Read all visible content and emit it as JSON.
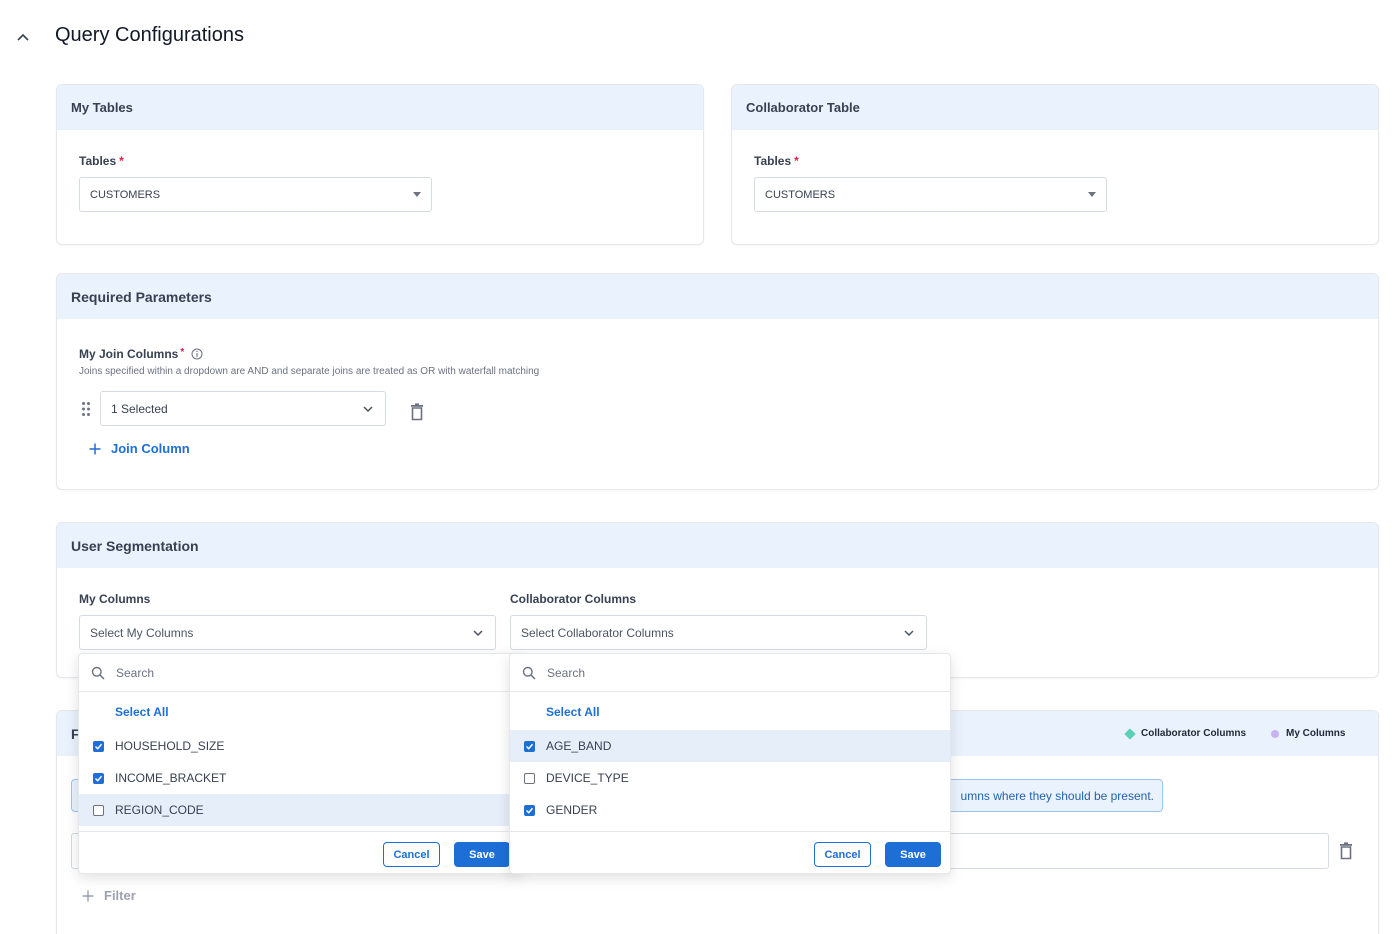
{
  "page": {
    "title": "Query Configurations"
  },
  "my_tables": {
    "header": "My Tables",
    "tables_label": "Tables",
    "required_mark": "*",
    "selected_table": "CUSTOMERS"
  },
  "collaborator_table": {
    "header": "Collaborator Table",
    "tables_label": "Tables",
    "required_mark": "*",
    "selected_table": "CUSTOMERS"
  },
  "required_parameters": {
    "header": "Required Parameters",
    "join_label": "My Join Columns",
    "required_mark": "*",
    "hint": "Joins specified within a dropdown are AND and separate joins are treated as OR with waterfall matching",
    "join_select_value": "1 Selected",
    "add_join_label": "Join Column"
  },
  "user_segmentation": {
    "header": "User Segmentation",
    "my_columns_label": "My Columns",
    "my_columns_placeholder": "Select My Columns",
    "collab_columns_label": "Collaborator Columns",
    "collab_columns_placeholder": "Select Collaborator Columns"
  },
  "my_columns_dropdown": {
    "search_placeholder": "Search",
    "select_all": "Select All",
    "items": [
      {
        "label": "HOUSEHOLD_SIZE",
        "checked": true
      },
      {
        "label": "INCOME_BRACKET",
        "checked": true
      },
      {
        "label": "REGION_CODE",
        "checked": false
      }
    ],
    "cancel": "Cancel",
    "save": "Save"
  },
  "collab_columns_dropdown": {
    "search_placeholder": "Search",
    "select_all": "Select All",
    "items": [
      {
        "label": "AGE_BAND",
        "checked": true
      },
      {
        "label": "DEVICE_TYPE",
        "checked": false
      },
      {
        "label": "GENDER",
        "checked": true
      }
    ],
    "cancel": "Cancel",
    "save": "Save"
  },
  "filters": {
    "header_initial": "F",
    "legend": {
      "collaborator": "Collaborator Columns",
      "mine": "My Columns"
    },
    "info_text": "umns where they should be present.",
    "add_filter_label": "Filter"
  },
  "colors": {
    "accent": "#1d6fd6",
    "header_bg": "#eaf2fd",
    "required": "#e11d48",
    "legend_collaborator": "#5fd0b8",
    "legend_mine": "#c7b3f3"
  }
}
